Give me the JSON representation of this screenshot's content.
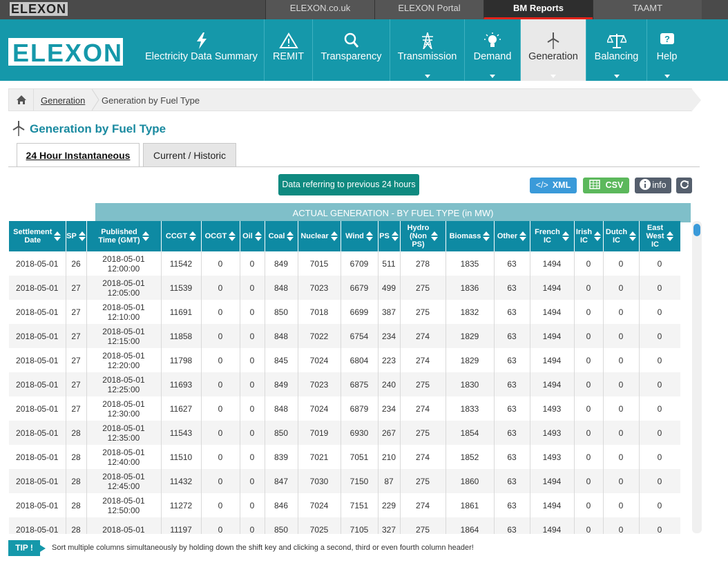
{
  "topbar": {
    "logo_text": "ELEXON",
    "tabs": [
      "ELEXON.co.uk",
      "ELEXON Portal",
      "BM Reports",
      "TAAMT"
    ]
  },
  "logo": "ELEXON",
  "nav": [
    {
      "label": "Electricity Data Summary",
      "icon": "lightning-icon"
    },
    {
      "label": "REMIT",
      "icon": "remit-warning-icon"
    },
    {
      "label": "Transparency",
      "icon": "search-icon"
    },
    {
      "label": "Transmission",
      "icon": "pylon-icon"
    },
    {
      "label": "Demand",
      "icon": "lightbulb-icon"
    },
    {
      "label": "Generation",
      "icon": "wind-turbine-icon"
    },
    {
      "label": "Balancing",
      "icon": "scales-icon"
    },
    {
      "label": "Help",
      "icon": "help-icon"
    }
  ],
  "breadcrumb": {
    "link": "Generation",
    "current": "Generation by Fuel Type"
  },
  "page_title": "Generation by Fuel Type",
  "tabs": {
    "active": "24 Hour Instantaneous",
    "inactive": "Current / Historic"
  },
  "data_ref": "Data referring to previous 24 hours",
  "buttons": {
    "xml_icon": "</>",
    "xml": "XML",
    "csv": "CSV",
    "info": "info"
  },
  "actual_header": "ACTUAL GENERATION - BY FUEL TYPE (in MW)",
  "columns": [
    [
      "Settlement",
      "Date"
    ],
    [
      "SP"
    ],
    [
      "Published",
      "Time (GMT)"
    ],
    [
      "CCGT"
    ],
    [
      "OCGT"
    ],
    [
      "Oil"
    ],
    [
      "Coal"
    ],
    [
      "Nuclear"
    ],
    [
      "Wind"
    ],
    [
      "PS"
    ],
    [
      "Hydro",
      "(Non",
      "PS)"
    ],
    [
      "Biomass"
    ],
    [
      "Other"
    ],
    [
      "French",
      "IC"
    ],
    [
      "Irish",
      "IC"
    ],
    [
      "Dutch",
      "IC"
    ],
    [
      "East",
      "West",
      "IC"
    ]
  ],
  "rows": [
    [
      "2018-05-01",
      "26",
      "2018-05-01",
      "12:00:00",
      "11542",
      "0",
      "0",
      "849",
      "7015",
      "6709",
      "511",
      "278",
      "1835",
      "63",
      "1494",
      "0",
      "0",
      "0"
    ],
    [
      "2018-05-01",
      "27",
      "2018-05-01",
      "12:05:00",
      "11539",
      "0",
      "0",
      "848",
      "7023",
      "6679",
      "499",
      "275",
      "1836",
      "63",
      "1494",
      "0",
      "0",
      "0"
    ],
    [
      "2018-05-01",
      "27",
      "2018-05-01",
      "12:10:00",
      "11691",
      "0",
      "0",
      "850",
      "7018",
      "6699",
      "387",
      "275",
      "1832",
      "63",
      "1494",
      "0",
      "0",
      "0"
    ],
    [
      "2018-05-01",
      "27",
      "2018-05-01",
      "12:15:00",
      "11858",
      "0",
      "0",
      "848",
      "7022",
      "6754",
      "234",
      "274",
      "1829",
      "63",
      "1494",
      "0",
      "0",
      "0"
    ],
    [
      "2018-05-01",
      "27",
      "2018-05-01",
      "12:20:00",
      "11798",
      "0",
      "0",
      "845",
      "7024",
      "6804",
      "223",
      "274",
      "1829",
      "63",
      "1494",
      "0",
      "0",
      "0"
    ],
    [
      "2018-05-01",
      "27",
      "2018-05-01",
      "12:25:00",
      "11693",
      "0",
      "0",
      "849",
      "7023",
      "6875",
      "240",
      "275",
      "1830",
      "63",
      "1494",
      "0",
      "0",
      "0"
    ],
    [
      "2018-05-01",
      "27",
      "2018-05-01",
      "12:30:00",
      "11627",
      "0",
      "0",
      "848",
      "7024",
      "6879",
      "234",
      "274",
      "1833",
      "63",
      "1493",
      "0",
      "0",
      "0"
    ],
    [
      "2018-05-01",
      "28",
      "2018-05-01",
      "12:35:00",
      "11543",
      "0",
      "0",
      "850",
      "7019",
      "6930",
      "267",
      "275",
      "1854",
      "63",
      "1493",
      "0",
      "0",
      "0"
    ],
    [
      "2018-05-01",
      "28",
      "2018-05-01",
      "12:40:00",
      "11510",
      "0",
      "0",
      "839",
      "7021",
      "7051",
      "210",
      "274",
      "1852",
      "63",
      "1493",
      "0",
      "0",
      "0"
    ],
    [
      "2018-05-01",
      "28",
      "2018-05-01",
      "12:45:00",
      "11432",
      "0",
      "0",
      "847",
      "7030",
      "7150",
      "87",
      "275",
      "1860",
      "63",
      "1494",
      "0",
      "0",
      "0"
    ],
    [
      "2018-05-01",
      "28",
      "2018-05-01",
      "12:50:00",
      "11272",
      "0",
      "0",
      "846",
      "7024",
      "7151",
      "229",
      "274",
      "1861",
      "63",
      "1494",
      "0",
      "0",
      "0"
    ],
    [
      "2018-05-01",
      "28",
      "2018-05-01",
      "",
      "11197",
      "0",
      "0",
      "850",
      "7025",
      "7105",
      "327",
      "275",
      "1864",
      "63",
      "1494",
      "0",
      "0",
      "0"
    ]
  ],
  "tip": {
    "badge": "TIP !",
    "text": "Sort multiple columns simultaneously by holding down the shift key and clicking a second, third or even fourth column header!"
  }
}
